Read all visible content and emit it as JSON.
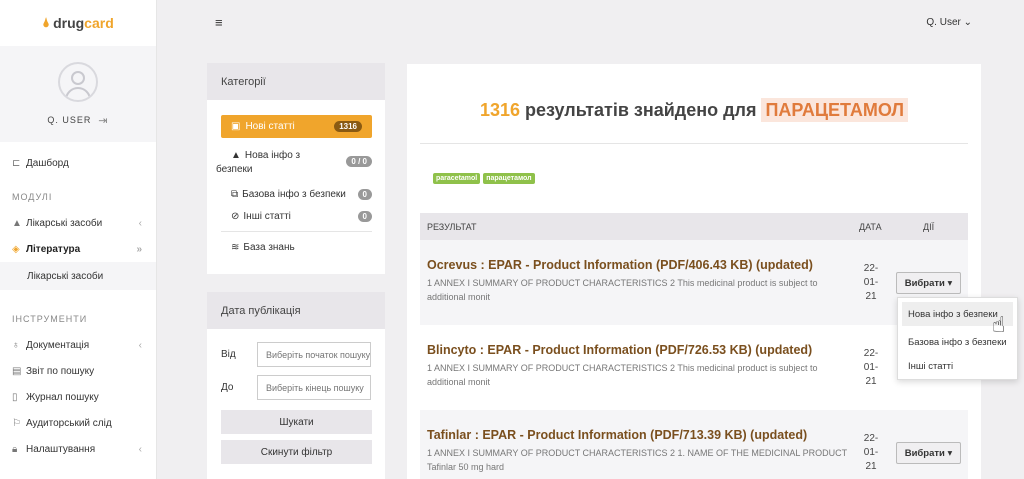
{
  "logo": {
    "drop": "🌢",
    "name": "drug",
    "accent": "card"
  },
  "profile": {
    "name": "Q. USER"
  },
  "topbar": {
    "user": "Q. User ⌄"
  },
  "sidebar": {
    "dashboard": "Дашборд",
    "modules_title": "МОДУЛІ",
    "drugs": "Лікарські засоби",
    "literature": "Література",
    "literature_sub": "Лікарські засоби",
    "tools_title": "ІНСТРУМЕНТИ",
    "docs": "Документація",
    "search_report": "Звіт по пошуку",
    "search_log": "Журнал пошуку",
    "audit": "Аудиторський слід",
    "settings": "Налаштування"
  },
  "categories": {
    "title": "Категорії",
    "new_articles": "Нові статті",
    "new_articles_count": "1316",
    "new_safety_line1": "Нова інфо з",
    "new_safety_line2": "безпеки",
    "new_safety_count": "0 / 0",
    "base_safety": "Базова інфо з безпеки",
    "base_safety_count": "0",
    "other": "Інші статті",
    "other_count": "0",
    "knowledge": "База знань"
  },
  "date_filter": {
    "title": "Дата публікація",
    "from_label": "Від",
    "from_placeholder": "Виберіть початок пошуку",
    "to_label": "До",
    "to_placeholder": "Виберіть кінець пошуку",
    "search_button": "Шукати",
    "reset_button": "Скинути фільтр"
  },
  "results": {
    "count": "1316",
    "found_text": " результатів знайдено для ",
    "query": "ПАРАЦЕТАМОЛ",
    "tags": [
      "paracetamol",
      "парацетамол"
    ],
    "col_result": "РЕЗУЛЬТАТ",
    "col_date": "ДАТА",
    "col_actions": "ДІЇ",
    "select_label": "Вибрати ▾",
    "rows": [
      {
        "title": "Ocrevus : EPAR - Product Information (PDF/406.43 KB) (updated)",
        "snippet": "1 ANNEX I SUMMARY OF PRODUCT CHARACTERISTICS 2 This medicinal product is subject to additional monit",
        "date": "22-01-21"
      },
      {
        "title": "Blincyto : EPAR - Product Information (PDF/726.53 KB) (updated)",
        "snippet": "1 ANNEX I SUMMARY OF PRODUCT CHARACTERISTICS 2 This medicinal product is subject to additional monit",
        "date": "22-01-21"
      },
      {
        "title": "Tafinlar : EPAR - Product Information (PDF/713.39 KB) (updated)",
        "snippet": "1 ANNEX I SUMMARY OF PRODUCT CHARACTERISTICS 2 1. NAME OF THE MEDICINAL PRODUCT Tafinlar 50 mg hard",
        "date": "22-01-21"
      }
    ]
  },
  "dropdown": {
    "item1": "Нова інфо з безпеки",
    "item2": "Базова інфо з безпеки",
    "item3": "Інші статті"
  },
  "colors": {
    "accent": "#f0a52c",
    "title_brown": "#7a4f1e",
    "tag_green": "#8fc14a"
  }
}
